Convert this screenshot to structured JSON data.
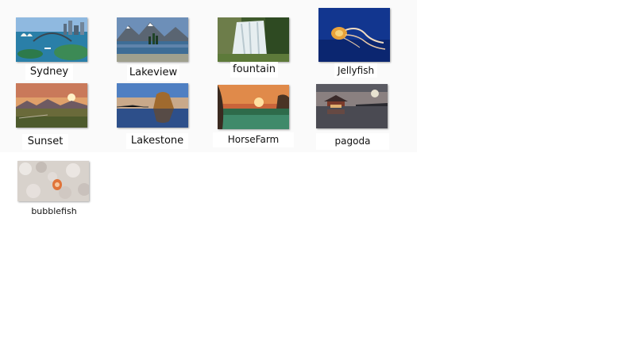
{
  "files": [
    {
      "name": "Sydney",
      "icon": "sydney-harbour-image"
    },
    {
      "name": "Lakeview",
      "icon": "mountain-lake-image"
    },
    {
      "name": "fountain",
      "icon": "waterfall-image"
    },
    {
      "name": "Jellyfish",
      "icon": "jellyfish-image"
    },
    {
      "name": "Sunset",
      "icon": "sunset-field-image"
    },
    {
      "name": "Lakestone",
      "icon": "rock-lake-image"
    },
    {
      "name": "HorseFarm",
      "icon": "misty-farm-image"
    },
    {
      "name": "pagoda",
      "icon": "pagoda-image"
    },
    {
      "name": "bubblefish",
      "icon": "bubblefish-image"
    }
  ],
  "colors": {
    "background": "#ffffff",
    "panel": "#fafafa",
    "label_text": "#111111"
  }
}
